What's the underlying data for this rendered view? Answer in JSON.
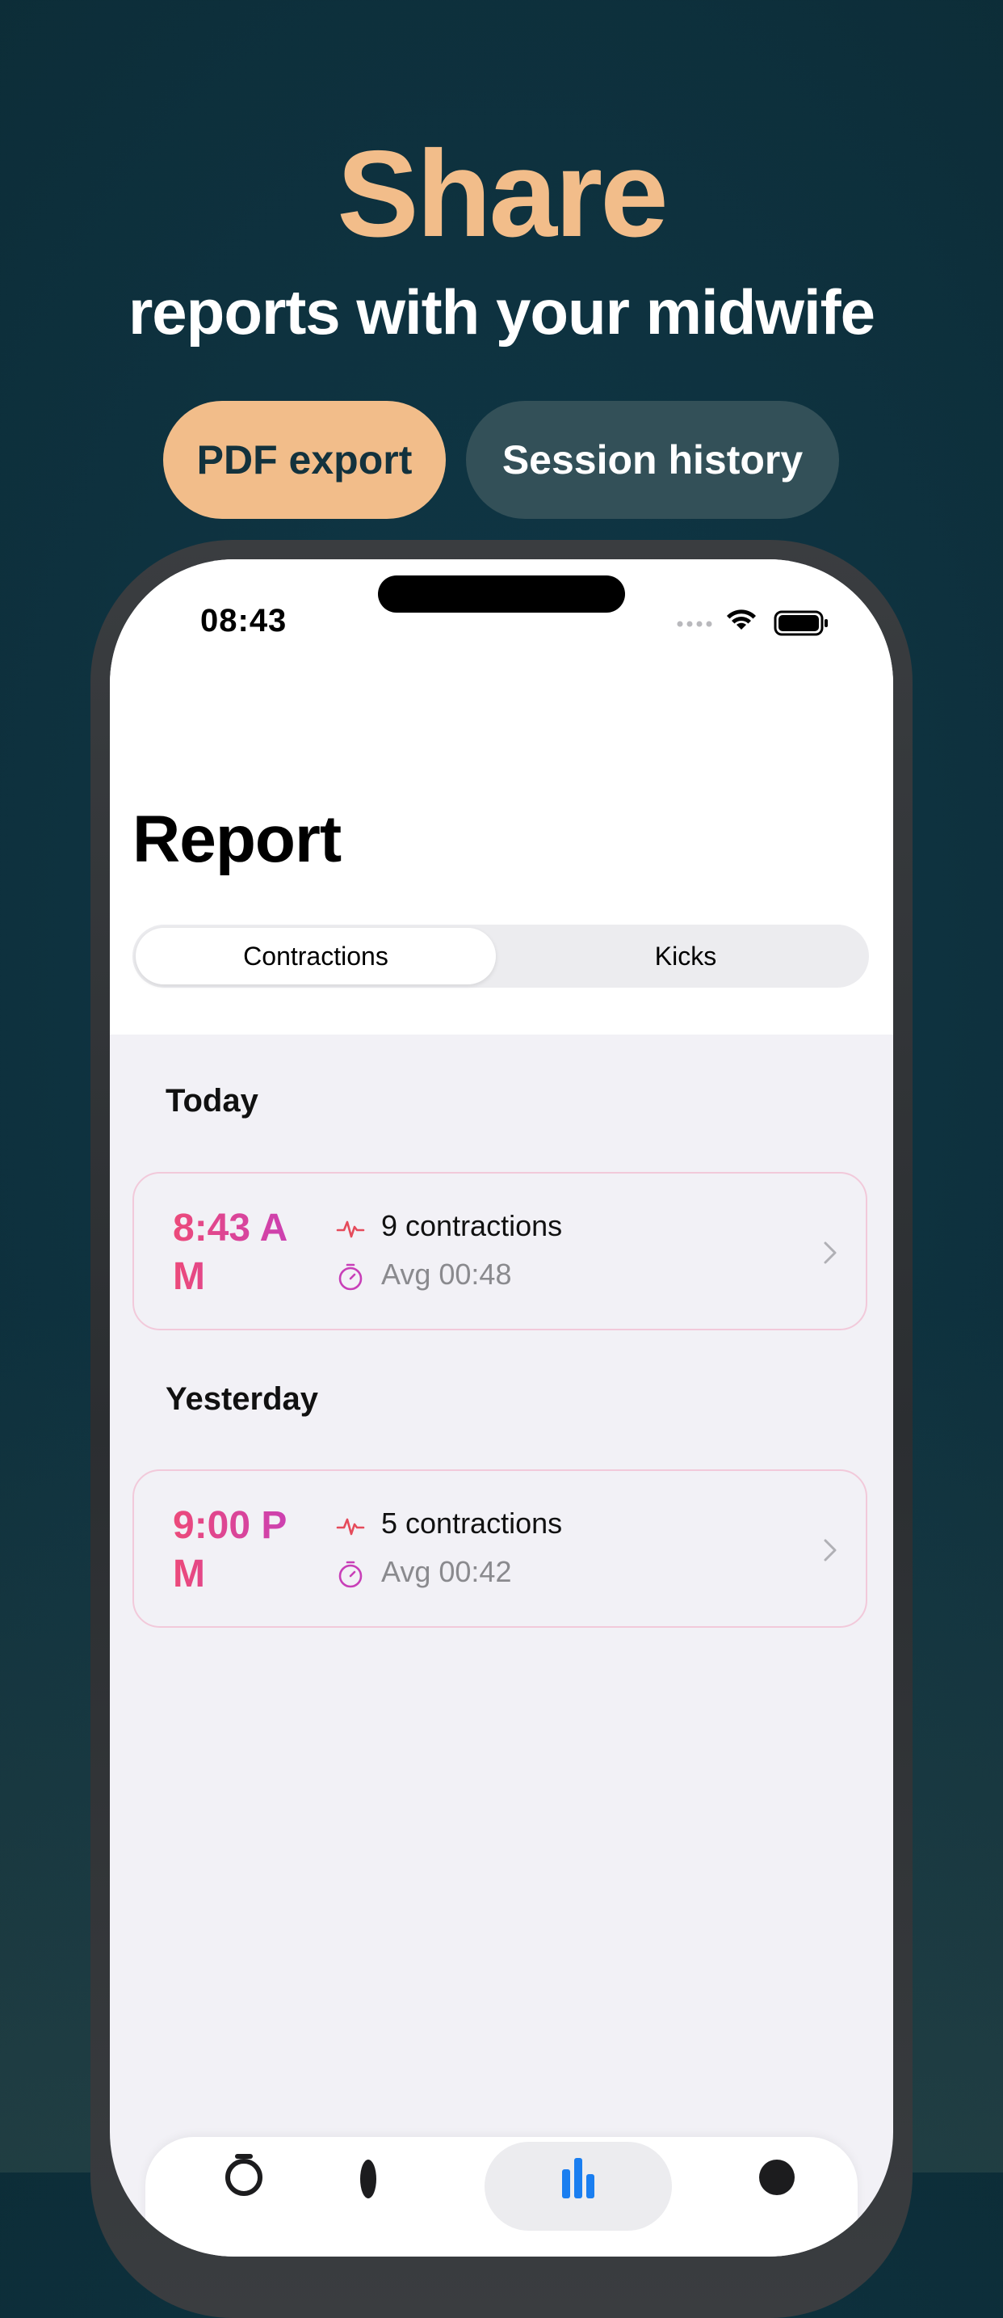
{
  "promo": {
    "headline": "Share",
    "subheadline": "reports with your midwife",
    "pills": {
      "pdf_export": "PDF export",
      "session_history": "Session history"
    }
  },
  "status_bar": {
    "time": "08:43"
  },
  "report": {
    "title": "Report",
    "tabs": {
      "contractions": "Contractions",
      "kicks": "Kicks"
    },
    "active_tab": "Contractions",
    "sections": [
      {
        "header": "Today",
        "sessions": [
          {
            "time": "8:43 AM",
            "count_label": "9 contractions",
            "avg_label": "Avg 00:48"
          }
        ]
      },
      {
        "header": "Yesterday",
        "sessions": [
          {
            "time": "9:00 PM",
            "count_label": "5 contractions",
            "avg_label": "Avg 00:42"
          }
        ]
      }
    ]
  },
  "tab_bar": {
    "icons": [
      "timer-icon",
      "foot-icon",
      "chart-icon",
      "profile-icon"
    ],
    "active_index": 2
  },
  "colors": {
    "accent_peach": "#f2bd8a",
    "background_teal": "#0d2f3b",
    "pill_dark": "#335058",
    "time_pink": "#e0418f",
    "card_border": "#f2c9da",
    "pulse_red": "#e54b5b",
    "timer_magenta": "#c83fb8",
    "tab_active_blue": "#1a7ef0"
  }
}
